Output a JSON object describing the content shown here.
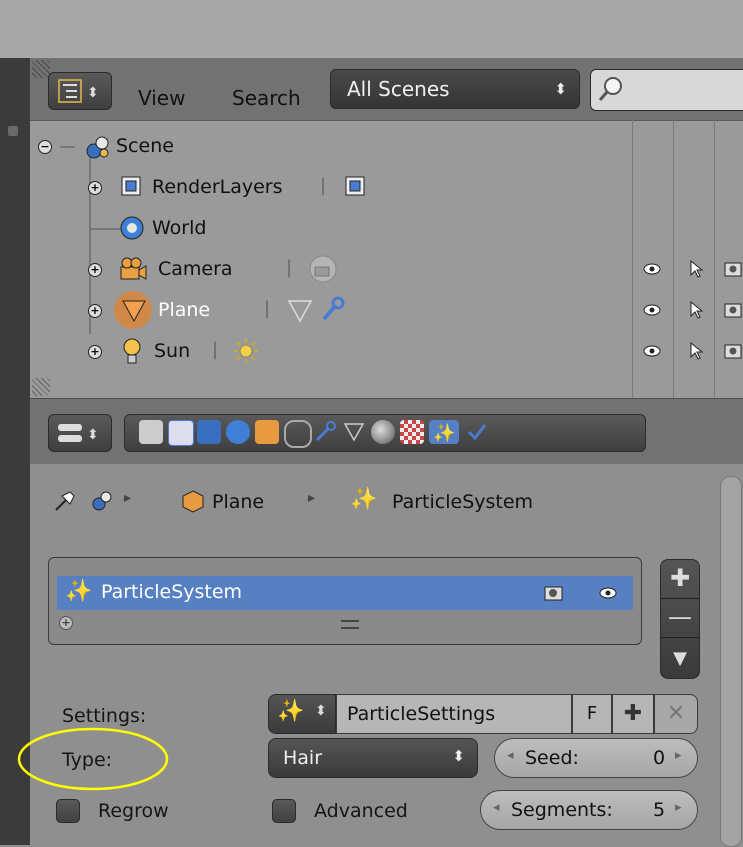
{
  "outliner": {
    "header": {
      "view_label": "View",
      "search_label": "Search",
      "scenes_combo": "All Scenes"
    },
    "tree": [
      {
        "name": "Scene",
        "icon": "scene-icon"
      },
      {
        "name": "RenderLayers",
        "icon": "renderlayers-icon"
      },
      {
        "name": "World",
        "icon": "world-icon"
      },
      {
        "name": "Camera",
        "icon": "camera-icon"
      },
      {
        "name": "Plane",
        "icon": "mesh-icon"
      },
      {
        "name": "Sun",
        "icon": "lamp-icon"
      }
    ]
  },
  "properties": {
    "breadcrumb": {
      "object": "Plane",
      "system": "ParticleSystem"
    },
    "particle_list": {
      "items": [
        {
          "name": "ParticleSystem",
          "selected": true
        }
      ]
    },
    "settings": {
      "label": "Settings:",
      "datablock": "ParticleSettings",
      "fake_user": "F"
    },
    "type": {
      "label": "Type:",
      "value": "Hair"
    },
    "seed": {
      "label": "Seed:",
      "value": "0"
    },
    "regrow": {
      "label": "Regrow",
      "checked": false
    },
    "advanced": {
      "label": "Advanced",
      "checked": false
    },
    "segments": {
      "label": "Segments:",
      "value": "5"
    }
  },
  "colors": {
    "selection": "#5680c2",
    "annotation": "#ffff00",
    "particles_tab": "#5680c2"
  }
}
